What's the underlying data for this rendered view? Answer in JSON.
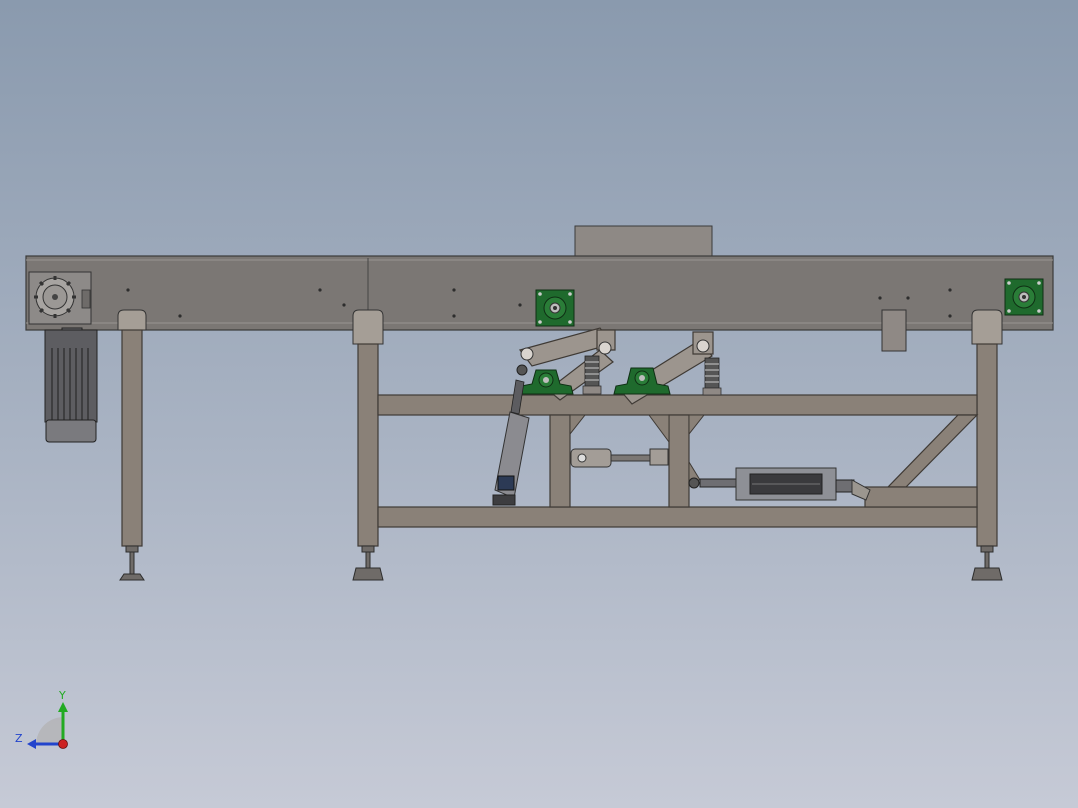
{
  "viewport": {
    "background_top": "#8a9aae",
    "background_bottom": "#c6cad6"
  },
  "triad": {
    "y_label": "Y",
    "z_label": "Z",
    "y_color": "#22aa22",
    "z_color": "#2244cc",
    "x_color": "#cc2222"
  },
  "colors": {
    "frame_fill": "#8a8178",
    "frame_stroke": "#3f3a35",
    "belt_fill": "#7b7774",
    "belt_stroke": "#3a3a3a",
    "bearing_green": "#1f6a2d",
    "motor_fill": "#6d6d70"
  },
  "icons": [
    "axis-triad-icon",
    "gear-icon",
    "bearing-icon"
  ]
}
